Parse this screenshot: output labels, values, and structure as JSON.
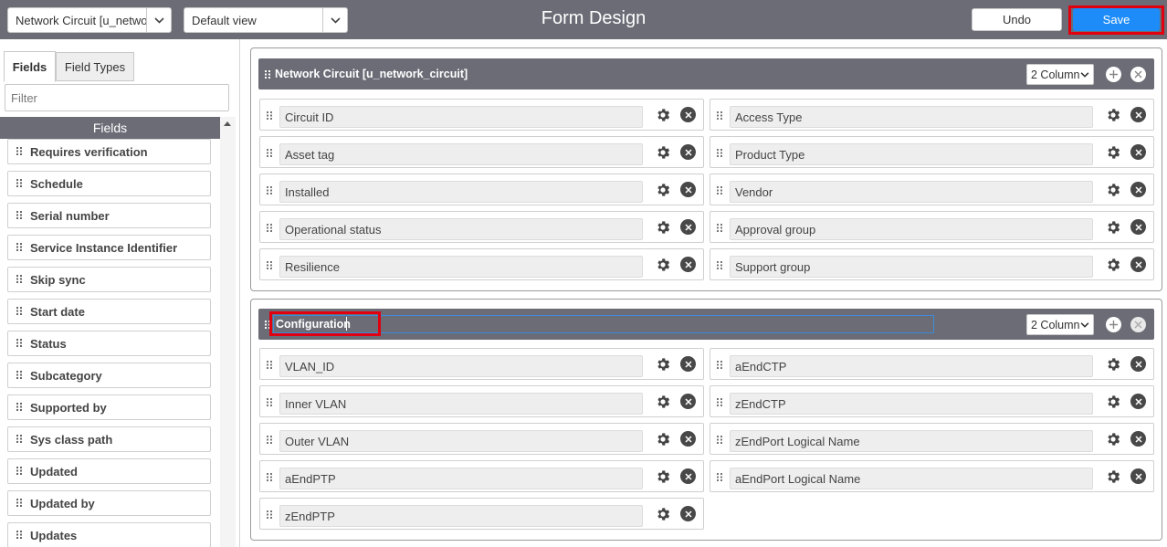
{
  "header": {
    "table_select": "Network Circuit [u_network_circuit]",
    "view_select": "Default view",
    "title": "Form Design",
    "undo_label": "Undo",
    "save_label": "Save"
  },
  "sidebar": {
    "tabs": [
      "Fields",
      "Field Types"
    ],
    "filter_placeholder": "Filter",
    "list_header": "Fields",
    "items": [
      "Requires verification",
      "Schedule",
      "Serial number",
      "Service Instance Identifier",
      "Skip sync",
      "Start date",
      "Status",
      "Subcategory",
      "Supported by",
      "Sys class path",
      "Updated",
      "Updated by",
      "Updates"
    ]
  },
  "sections": [
    {
      "title": "Network Circuit [u_network_circuit]",
      "columns": "2 Column",
      "left_fields": [
        "Circuit ID",
        "Asset tag",
        "Installed",
        "Operational status",
        "Resilience"
      ],
      "right_fields": [
        "Access Type",
        "Product Type",
        "Vendor",
        "Approval group",
        "Support group"
      ]
    },
    {
      "title": "Configuration",
      "columns": "2 Column",
      "left_fields": [
        "VLAN_ID",
        "Inner VLAN",
        "Outer VLAN",
        "aEndPTP",
        "zEndPTP"
      ],
      "right_fields": [
        "aEndCTP",
        "zEndCTP",
        "zEndPort Logical Name",
        "aEndPort Logical Name"
      ]
    }
  ],
  "colors": {
    "header_bg": "#6b6c76",
    "save_bg": "#1d8cf8",
    "highlight": "#e00010"
  }
}
